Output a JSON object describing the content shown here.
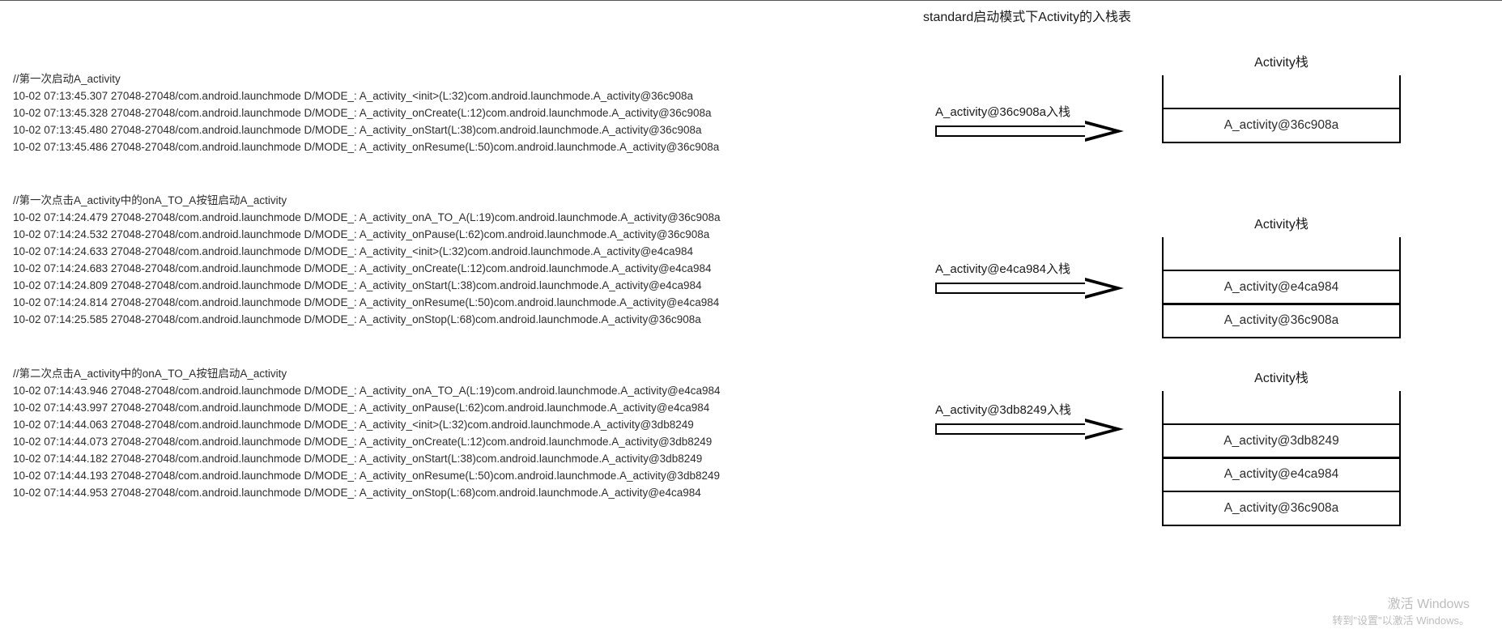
{
  "title": "standard启动模式下Activity的入栈表",
  "blocks": [
    {
      "comment": "//第一次启动A_activity",
      "lines": [
        "10-02 07:13:45.307 27048-27048/com.android.launchmode D/MODE_: A_activity_<init>(L:32)com.android.launchmode.A_activity@36c908a",
        "10-02 07:13:45.328 27048-27048/com.android.launchmode D/MODE_: A_activity_onCreate(L:12)com.android.launchmode.A_activity@36c908a",
        "10-02 07:13:45.480 27048-27048/com.android.launchmode D/MODE_: A_activity_onStart(L:38)com.android.launchmode.A_activity@36c908a",
        "10-02 07:13:45.486 27048-27048/com.android.launchmode D/MODE_: A_activity_onResume(L:50)com.android.launchmode.A_activity@36c908a"
      ]
    },
    {
      "comment": "//第一次点击A_activity中的onA_TO_A按钮启动A_activity",
      "lines": [
        "10-02 07:14:24.479 27048-27048/com.android.launchmode D/MODE_: A_activity_onA_TO_A(L:19)com.android.launchmode.A_activity@36c908a",
        "10-02 07:14:24.532 27048-27048/com.android.launchmode D/MODE_: A_activity_onPause(L:62)com.android.launchmode.A_activity@36c908a",
        "10-02 07:14:24.633 27048-27048/com.android.launchmode D/MODE_: A_activity_<init>(L:32)com.android.launchmode.A_activity@e4ca984",
        "10-02 07:14:24.683 27048-27048/com.android.launchmode D/MODE_: A_activity_onCreate(L:12)com.android.launchmode.A_activity@e4ca984",
        "10-02 07:14:24.809 27048-27048/com.android.launchmode D/MODE_: A_activity_onStart(L:38)com.android.launchmode.A_activity@e4ca984",
        "10-02 07:14:24.814 27048-27048/com.android.launchmode D/MODE_: A_activity_onResume(L:50)com.android.launchmode.A_activity@e4ca984",
        "10-02 07:14:25.585 27048-27048/com.android.launchmode D/MODE_: A_activity_onStop(L:68)com.android.launchmode.A_activity@36c908a"
      ]
    },
    {
      "comment": "//第二次点击A_activity中的onA_TO_A按钮启动A_activity",
      "lines": [
        "10-02 07:14:43.946 27048-27048/com.android.launchmode D/MODE_: A_activity_onA_TO_A(L:19)com.android.launchmode.A_activity@e4ca984",
        "10-02 07:14:43.997 27048-27048/com.android.launchmode D/MODE_: A_activity_onPause(L:62)com.android.launchmode.A_activity@e4ca984",
        "10-02 07:14:44.063 27048-27048/com.android.launchmode D/MODE_: A_activity_<init>(L:32)com.android.launchmode.A_activity@3db8249",
        "10-02 07:14:44.073 27048-27048/com.android.launchmode D/MODE_: A_activity_onCreate(L:12)com.android.launchmode.A_activity@3db8249",
        "10-02 07:14:44.182 27048-27048/com.android.launchmode D/MODE_: A_activity_onStart(L:38)com.android.launchmode.A_activity@3db8249",
        "10-02 07:14:44.193 27048-27048/com.android.launchmode D/MODE_: A_activity_onResume(L:50)com.android.launchmode.A_activity@3db8249",
        "10-02 07:14:44.953 27048-27048/com.android.launchmode D/MODE_: A_activity_onStop(L:68)com.android.launchmode.A_activity@e4ca984"
      ]
    }
  ],
  "arrows": [
    {
      "label": "A_activity@36c908a入栈"
    },
    {
      "label": "A_activity@e4ca984入栈"
    },
    {
      "label": "A_activity@3db8249入栈"
    }
  ],
  "stacks": [
    {
      "title": "Activity栈",
      "cells": [
        "A_activity@36c908a"
      ]
    },
    {
      "title": "Activity栈",
      "cells": [
        "A_activity@e4ca984",
        "A_activity@36c908a"
      ]
    },
    {
      "title": "Activity栈",
      "cells": [
        "A_activity@3db8249",
        "A_activity@e4ca984",
        "A_activity@36c908a"
      ]
    }
  ],
  "watermark": {
    "line1": "激活 Windows",
    "line2": "转到\"设置\"以激活 Windows。"
  }
}
